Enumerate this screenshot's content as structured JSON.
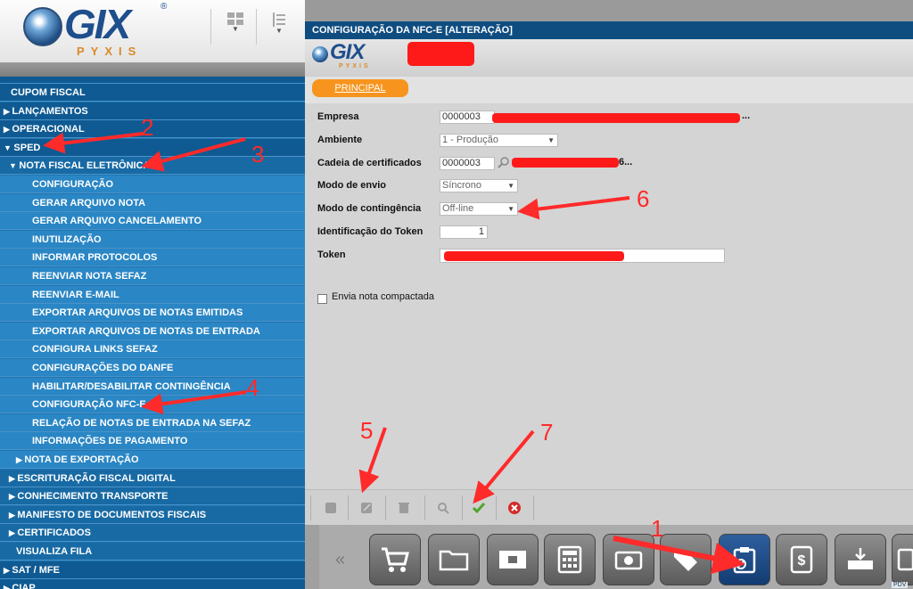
{
  "app": {
    "logo_text": "GIX",
    "logo_sub": "PYXIS",
    "reg_mark": "®"
  },
  "toolbar": {
    "icon1": "grid-view-icon",
    "icon2": "list-view-icon"
  },
  "menu": {
    "items": [
      {
        "label": "CUPOM FISCAL",
        "prefix": "",
        "level": 0
      },
      {
        "label": "LANÇAMENTOS",
        "prefix": "▶",
        "level": 0
      },
      {
        "label": "OPERACIONAL",
        "prefix": "▶",
        "level": 0
      },
      {
        "label": "SPED",
        "prefix": "▼",
        "level": 0
      },
      {
        "label": "NOTA FISCAL ELETRÔNICA",
        "prefix": "▼",
        "level": 1
      },
      {
        "label": "CONFIGURAÇÃO",
        "prefix": "",
        "level": 2
      },
      {
        "label": "GERAR ARQUIVO NOTA",
        "prefix": "",
        "level": 2
      },
      {
        "label": "GERAR ARQUIVO CANCELAMENTO",
        "prefix": "",
        "level": 2
      },
      {
        "label": "INUTILIZAÇÃO",
        "prefix": "",
        "level": 2
      },
      {
        "label": "INFORMAR PROTOCOLOS",
        "prefix": "",
        "level": 2
      },
      {
        "label": "REENVIAR NOTA SEFAZ",
        "prefix": "",
        "level": 2
      },
      {
        "label": "REENVIAR E-MAIL",
        "prefix": "",
        "level": 2
      },
      {
        "label": "EXPORTAR ARQUIVOS DE NOTAS EMITIDAS",
        "prefix": "",
        "level": 2
      },
      {
        "label": "EXPORTAR ARQUIVOS DE NOTAS DE ENTRADA",
        "prefix": "",
        "level": 2
      },
      {
        "label": "CONFIGURA LINKS SEFAZ",
        "prefix": "",
        "level": 2
      },
      {
        "label": "CONFIGURAÇÕES DO DANFE",
        "prefix": "",
        "level": 2
      },
      {
        "label": "HABILITAR/DESABILITAR CONTINGÊNCIA",
        "prefix": "",
        "level": 2
      },
      {
        "label": "CONFIGURAÇÃO NFC-E",
        "prefix": "",
        "level": 2
      },
      {
        "label": "RELAÇÃO DE NOTAS DE ENTRADA NA SEFAZ",
        "prefix": "",
        "level": 2
      },
      {
        "label": "INFORMAÇÕES DE PAGAMENTO",
        "prefix": "",
        "level": 2
      },
      {
        "label": "NOTA DE EXPORTAÇÃO",
        "prefix": "▶",
        "level": 2
      },
      {
        "label": "ESCRITURAÇÃO FISCAL DIGITAL",
        "prefix": "▶",
        "level": 1
      },
      {
        "label": "CONHECIMENTO TRANSPORTE",
        "prefix": "▶",
        "level": 1
      },
      {
        "label": "MANIFESTO DE DOCUMENTOS FISCAIS",
        "prefix": "▶",
        "level": 1
      },
      {
        "label": "CERTIFICADOS",
        "prefix": "▶",
        "level": 1
      },
      {
        "label": "VISUALIZA FILA",
        "prefix": "",
        "level": 1
      },
      {
        "label": "SAT / MFE",
        "prefix": "▶",
        "level": 0
      },
      {
        "label": "CIAP",
        "prefix": "▶",
        "level": 0
      }
    ]
  },
  "window": {
    "title": "CONFIGURAÇÃO DA NFC-E  [ALTERAÇÃO]",
    "tab": "PRINCIPAL"
  },
  "form": {
    "empresa_label": "Empresa",
    "empresa_value": "0000003",
    "ambiente_label": "Ambiente",
    "ambiente_value": "1 - Produção",
    "cadeia_label": "Cadeia de certificados",
    "cadeia_value": "0000003",
    "modo_envio_label": "Modo de envio",
    "modo_envio_value": "Síncrono",
    "modo_cont_label": "Modo de contingência",
    "modo_cont_value": "Off-line",
    "token_id_label": "Identificação do Token",
    "token_id_value": "1",
    "token_label": "Token",
    "token_value": "",
    "checkbox_label": "Envia nota compactada",
    "checkbox_checked": false,
    "ellipsis": "...",
    "ellipsis2": "6..."
  },
  "bottom_toolbar": {
    "buttons": [
      "new-icon",
      "edit-icon",
      "delete-icon",
      "search-icon",
      "confirm-check-icon",
      "cancel-icon"
    ]
  },
  "dock": {
    "icons": [
      "shopping-cart-icon",
      "folder-icon",
      "register-icon",
      "calculator-icon",
      "cash-icon",
      "tag-icon",
      "fiscal-clipboard-icon",
      "money-document-icon",
      "inbox-tray-icon",
      "printer-icon"
    ],
    "pdv_label": "PDV"
  },
  "annotations": [
    "1",
    "2",
    "3",
    "4",
    "5",
    "6",
    "7"
  ],
  "colors": {
    "menu_dark": "#0f5a92",
    "menu_mid": "#186aa4",
    "menu_light": "#2a86c4",
    "title_bar": "#0f4d80",
    "tab_active": "#f7941d",
    "annotation_red": "#ff2a2a",
    "redaction_red": "#ff1a1a"
  }
}
